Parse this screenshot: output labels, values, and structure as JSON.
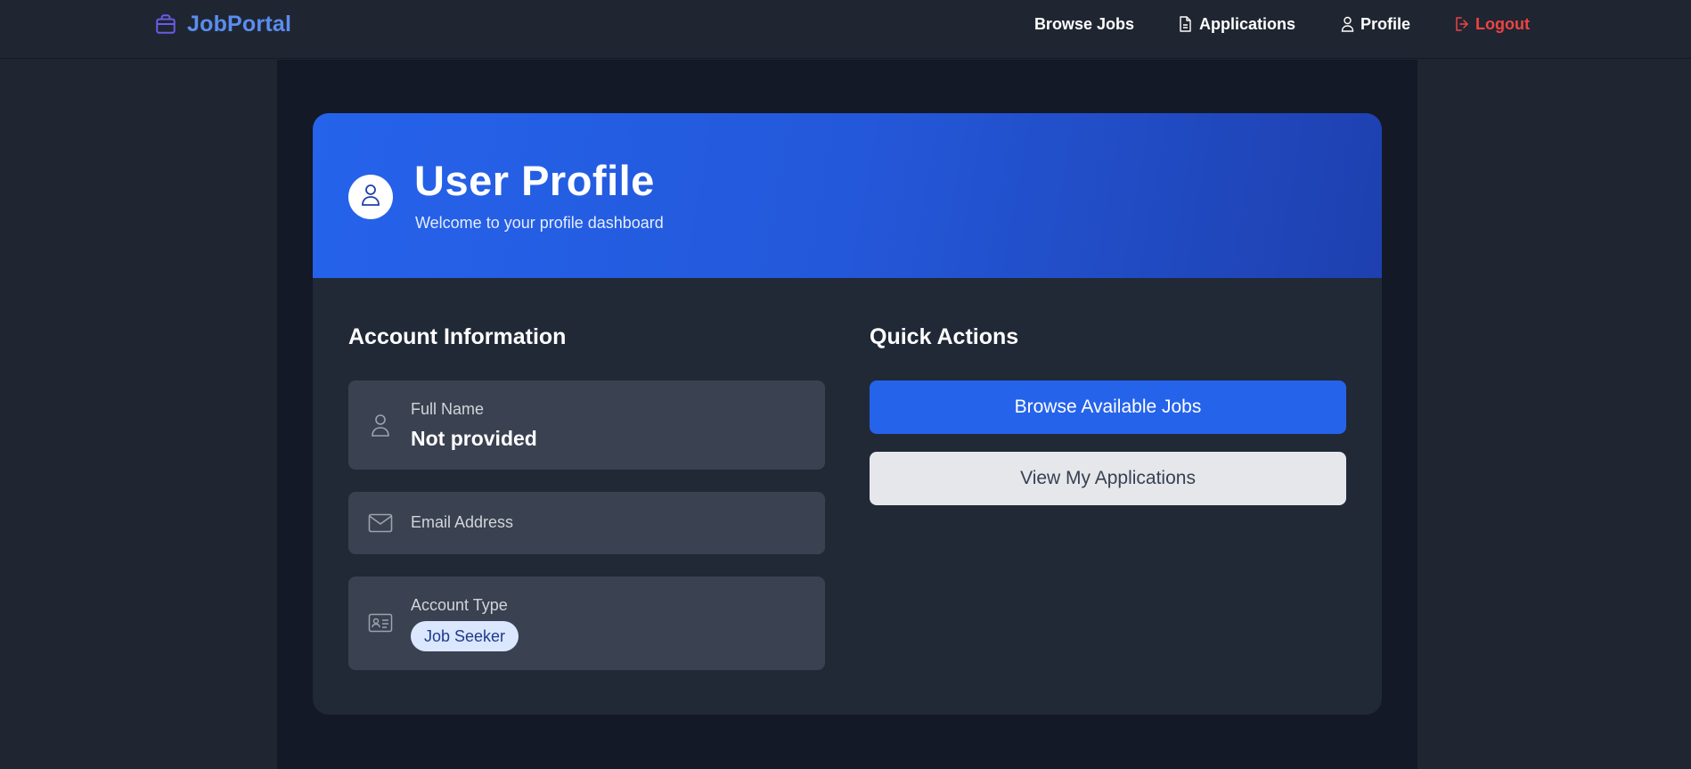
{
  "brand": {
    "name": "JobPortal",
    "icon": "briefcase-icon"
  },
  "nav": {
    "browse_jobs": "Browse Jobs",
    "applications": "Applications",
    "profile": "Profile",
    "logout": "Logout"
  },
  "header": {
    "title": "User Profile",
    "subtitle": "Welcome to your profile dashboard"
  },
  "account": {
    "section_title": "Account Information",
    "full_name_label": "Full Name",
    "full_name_value": "Not provided",
    "email_label": "Email Address",
    "account_type_label": "Account Type",
    "account_type_value": "Job Seeker"
  },
  "quick_actions": {
    "section_title": "Quick Actions",
    "browse_button": "Browse Available Jobs",
    "applications_button": "View My Applications"
  },
  "colors": {
    "accent": "#2563eb",
    "brand": "#5b8def",
    "logout": "#ef4444",
    "background": "#1f2631"
  }
}
